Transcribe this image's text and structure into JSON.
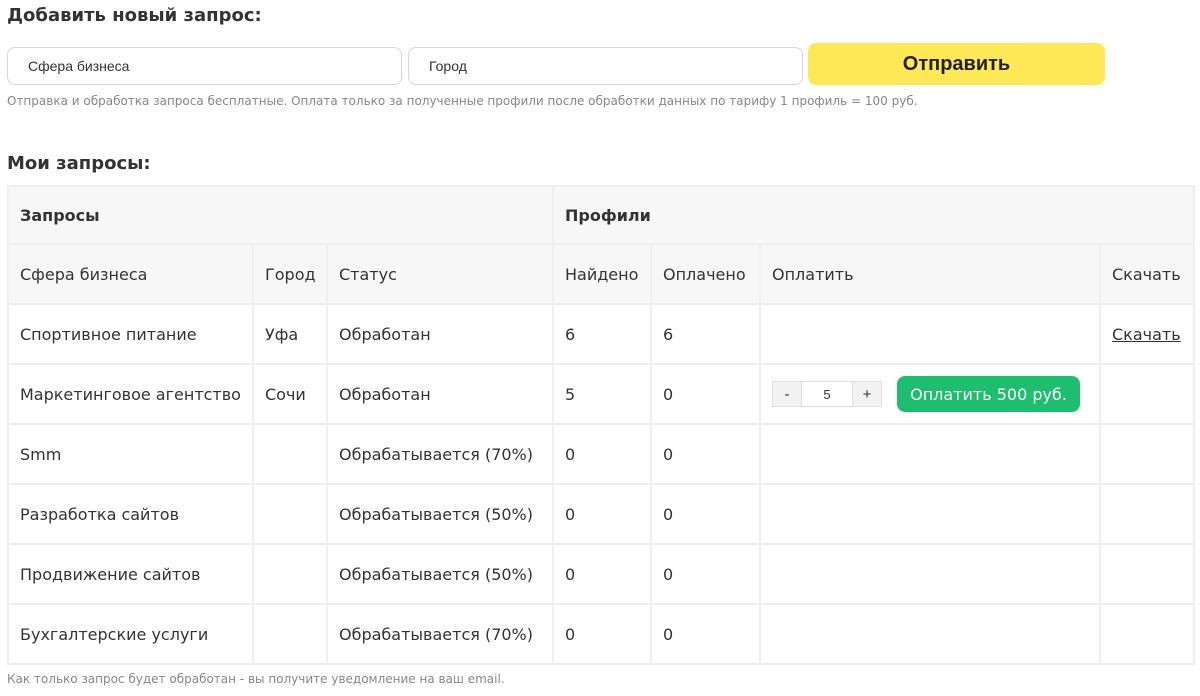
{
  "add_request": {
    "heading": "Добавить новый запрос:",
    "business_placeholder": "Сфера бизнеса",
    "city_placeholder": "Город",
    "submit_label": "Отправить",
    "note": "Отправка и обработка запроса бесплатные. Оплата только за полученные профили после обработки данных по тарифу 1 профиль = 100 руб."
  },
  "my_requests": {
    "heading": "Мои запросы:",
    "group_headers": {
      "requests": "Запросы",
      "profiles": "Профили"
    },
    "columns": {
      "business": "Сфера бизнеса",
      "city": "Город",
      "status": "Статус",
      "found": "Найдено",
      "paid": "Оплачено",
      "pay": "Оплатить",
      "download": "Скачать"
    },
    "rows": [
      {
        "business": "Спортивное питание",
        "city": "Уфа",
        "status": "Обработан",
        "found": "6",
        "paid": "6",
        "download_label": "Скачать"
      },
      {
        "business": "Маркетинговое агентство",
        "city": "Сочи",
        "status": "Обработан",
        "found": "5",
        "paid": "0",
        "pay": {
          "minus": "-",
          "quantity": "5",
          "plus": "+",
          "button_label": "Оплатить 500 руб."
        }
      },
      {
        "business": "Smm",
        "city": "",
        "status": "Обрабатывается (70%)",
        "found": "0",
        "paid": "0"
      },
      {
        "business": "Разработка сайтов",
        "city": "",
        "status": "Обрабатывается (50%)",
        "found": "0",
        "paid": "0"
      },
      {
        "business": "Продвижение сайтов",
        "city": "",
        "status": "Обрабатывается (50%)",
        "found": "0",
        "paid": "0"
      },
      {
        "business": "Бухгалтерские услуги",
        "city": "",
        "status": "Обрабатывается (70%)",
        "found": "0",
        "paid": "0"
      }
    ],
    "footer_note": "Как только запрос будет обработан - вы получите уведомление на ваш email."
  },
  "colors": {
    "submit": "#ffe856",
    "pay_button": "#1fbd6f",
    "header_bg": "#f7f7f7",
    "border": "#efefef"
  }
}
